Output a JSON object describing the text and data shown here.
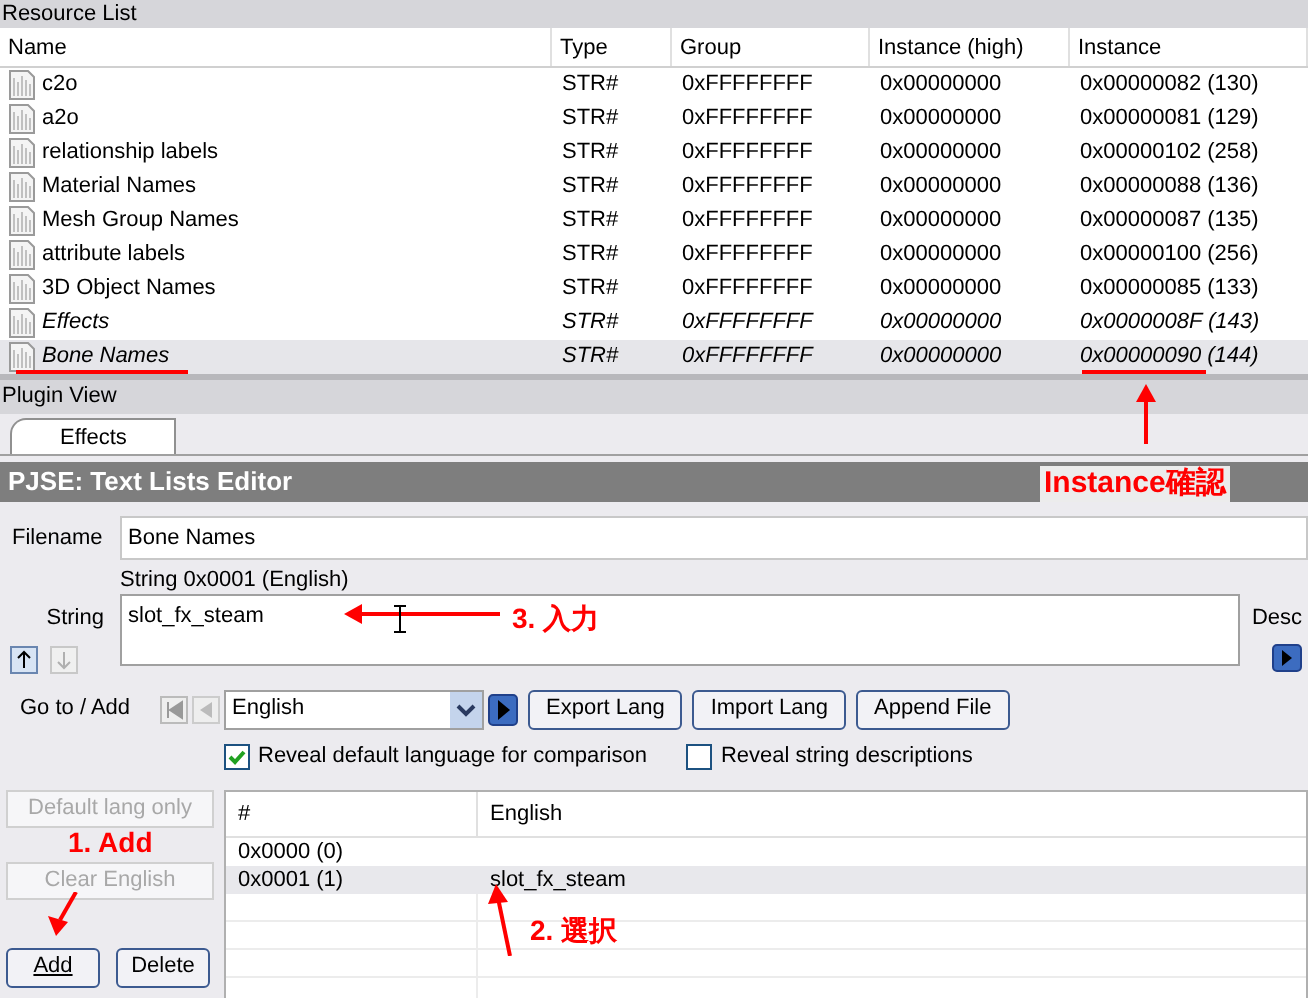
{
  "resource_list": {
    "title": "Resource List",
    "columns": [
      "Name",
      "Type",
      "Group",
      "Instance (high)",
      "Instance"
    ],
    "rows": [
      {
        "cells": [
          "c2o",
          "STR#",
          "0xFFFFFFFF",
          "0x00000000",
          "0x00000082 (130)"
        ],
        "modified": false,
        "selected": false
      },
      {
        "cells": [
          "a2o",
          "STR#",
          "0xFFFFFFFF",
          "0x00000000",
          "0x00000081 (129)"
        ],
        "modified": false,
        "selected": false
      },
      {
        "cells": [
          "relationship labels",
          "STR#",
          "0xFFFFFFFF",
          "0x00000000",
          "0x00000102 (258)"
        ],
        "modified": false,
        "selected": false
      },
      {
        "cells": [
          "Material Names",
          "STR#",
          "0xFFFFFFFF",
          "0x00000000",
          "0x00000088 (136)"
        ],
        "modified": false,
        "selected": false
      },
      {
        "cells": [
          "Mesh Group Names",
          "STR#",
          "0xFFFFFFFF",
          "0x00000000",
          "0x00000087 (135)"
        ],
        "modified": false,
        "selected": false
      },
      {
        "cells": [
          "attribute labels",
          "STR#",
          "0xFFFFFFFF",
          "0x00000000",
          "0x00000100 (256)"
        ],
        "modified": false,
        "selected": false
      },
      {
        "cells": [
          "3D Object Names",
          "STR#",
          "0xFFFFFFFF",
          "0x00000000",
          "0x00000085 (133)"
        ],
        "modified": false,
        "selected": false
      },
      {
        "cells": [
          "Effects",
          "STR#",
          "0xFFFFFFFF",
          "0x00000000",
          "0x0000008F (143)"
        ],
        "modified": true,
        "selected": false
      },
      {
        "cells": [
          "Bone Names",
          "STR#",
          "0xFFFFFFFF",
          "0x00000000",
          "0x00000090 (144)"
        ],
        "modified": true,
        "selected": true
      }
    ]
  },
  "plugin_view": {
    "title": "Plugin View",
    "tabs": [
      {
        "label": "Effects",
        "selected": true
      }
    ],
    "editor_title": "PJSE: Text Lists Editor",
    "filename_label": "Filename",
    "filename": "Bone Names",
    "string_caption": "String 0x0001 (English)",
    "string_label": "String",
    "string_value": "slot_fx_steam",
    "desc_label": "Desc",
    "goto_label": "Go to / Add",
    "language": "English",
    "buttons": [
      "Export Lang",
      "Import Lang",
      "Append File"
    ],
    "checkboxes": [
      {
        "label": "Reveal default language for comparison",
        "checked": true
      },
      {
        "label": "Reveal string descriptions",
        "checked": false
      }
    ],
    "side_buttons": [
      {
        "label": "Default lang only",
        "disabled": true
      },
      {
        "label": "Clear English",
        "disabled": true
      }
    ],
    "add_button": "Add",
    "delete_button": "Delete",
    "list_columns": [
      "#",
      "English"
    ],
    "list_rows": [
      {
        "cells": [
          "0x0000 (0)",
          ""
        ],
        "selected": false
      },
      {
        "cells": [
          "0x0001 (1)",
          "slot_fx_steam"
        ],
        "selected": true
      }
    ]
  },
  "annotations": [
    {
      "text": "Instance確認"
    },
    {
      "text": "3. 入力"
    },
    {
      "text": "1. Add"
    },
    {
      "text": "2. 選択"
    }
  ]
}
